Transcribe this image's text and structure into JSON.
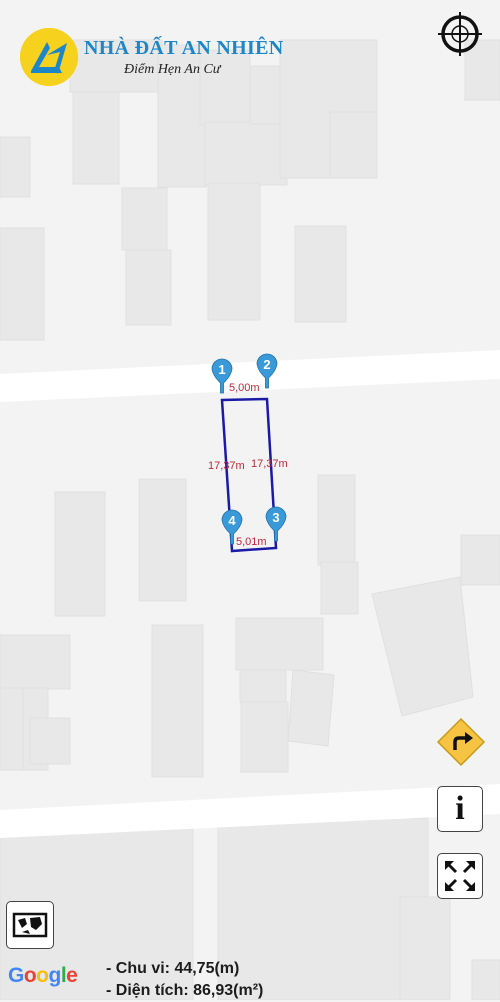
{
  "brand": {
    "name": "NHÀ ĐẤT AN NHIÊN",
    "slogan": "Điểm Hẹn An Cư",
    "colors": {
      "logo_bg": "#f6d21f",
      "logo_mark": "#1d86c8",
      "name": "#1d86c8"
    }
  },
  "controls": {
    "locate_icon": "crosshair-icon",
    "directions_icon": "turn-right-sign-icon",
    "info_label": "i",
    "fit_icon": "expand-arrows-icon",
    "layers_icon": "map-layers-icon"
  },
  "plot": {
    "outline_color": "#1a1aa6",
    "marker_color": "#3a9ad9",
    "label_color": "#c0283a",
    "markers": [
      "1",
      "2",
      "3",
      "4"
    ],
    "edges": {
      "top": "5,00m",
      "left": "17,37m",
      "right": "17,37m",
      "bottom": "5,01m"
    }
  },
  "attribution": "Google",
  "stats": {
    "perimeter": "- Chu vi: 44,75(m)",
    "area": "- Diện tích: 86,93(m²)"
  }
}
